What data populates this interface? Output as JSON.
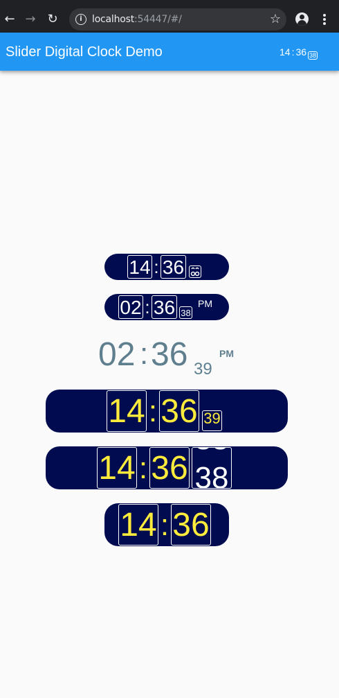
{
  "browser": {
    "back_icon": "arrow-left-icon",
    "forward_icon": "arrow-right-icon",
    "reload_icon": "reload-icon",
    "url_host": "localhost",
    "url_rest": ":54447/#/"
  },
  "app_bar": {
    "title": "Slider Digital Clock Demo",
    "clock": {
      "hours": "14",
      "separator": ":",
      "minutes": "36",
      "seconds": "38"
    }
  },
  "clocks": {
    "clock1": {
      "hours": "14",
      "separator": ":",
      "minutes": "36"
    },
    "clock2": {
      "hours": "02",
      "separator": ":",
      "minutes": "36",
      "seconds": "38",
      "period": "PM"
    },
    "clock3": {
      "hours": "02",
      "separator": ":",
      "minutes": "36",
      "seconds": "39",
      "period": "PM"
    },
    "clock4": {
      "hours": "14",
      "separator": ":",
      "minutes": "36",
      "seconds": "39"
    },
    "clock5": {
      "hours": "14",
      "separator": ":",
      "minutes": "36",
      "seconds": "38"
    },
    "clock6": {
      "hours": "14",
      "separator": ":",
      "minutes": "36"
    }
  },
  "colors": {
    "app_bar": "#2196f3",
    "clock_background": "#000c4f",
    "digit_yellow": "#ffeb3b",
    "plain_clock_text": "#5f7f8f"
  }
}
